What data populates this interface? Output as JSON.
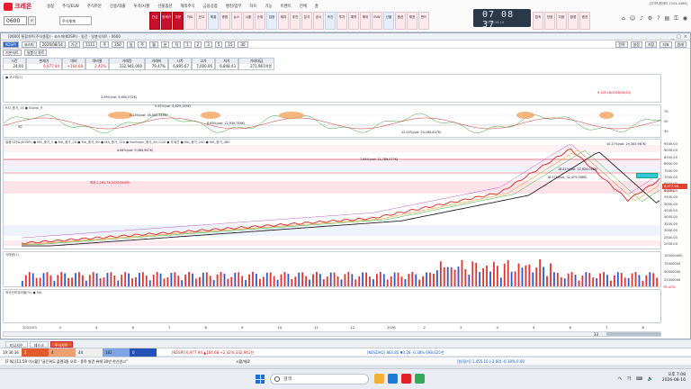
{
  "app": {
    "name": "크레온",
    "menu": [
      "설정",
      "주식/ELW",
      "주식주문",
      "신용/대출",
      "투자/시황",
      "선물옵션",
      "해외주식",
      "금융상품",
      "뱅킹/업무",
      "차트",
      "기능",
      "이벤트",
      "전체",
      "홈"
    ],
    "code_input": "0600",
    "account_select": "주식체계",
    "tiles": [
      "관심",
      "현재가",
      "주문",
      "차트",
      "잔고",
      "체결",
      "종합",
      "뉴스",
      "시황",
      "순위",
      "업종",
      "테마",
      "추천",
      "분석",
      "공시",
      "조건",
      "투자",
      "예약",
      "해외",
      "ELW",
      "선물",
      "옵션",
      "채권",
      "펀드"
    ],
    "right_tiles": [
      "접속",
      "전광",
      "다음",
      "환경",
      "증권"
    ],
    "clock": {
      "time": "07 08 37",
      "date": "2026.08.16"
    },
    "top_right_text": "[고객지원센터 1544-4488]",
    "top_icons": [
      "home-icon",
      "user-icon",
      "alarm-icon",
      "settings-icon",
      "help-icon",
      "print-icon",
      "lock-icon",
      "camera-icon"
    ]
  },
  "window": {
    "title": "[0600] 통합차트(주식종합) - 코스피(KOSPI) - 일간 - 일봉식차트 - 0600",
    "controls": [
      "_",
      "□",
      "×"
    ],
    "toolbar": [
      "KOSPI",
      "코스피",
      "2026/08/14",
      "기간",
      "1111",
      "주",
      "350",
      "일",
      "주",
      "월",
      "분",
      "틱",
      "1",
      "2",
      "3",
      "5",
      "15",
      "30"
    ],
    "toolbar2": [
      "기본차트",
      "일봉식 차트"
    ],
    "right_tools": [
      "전략",
      "설정",
      "저장"
    ],
    "right_tools2": [
      "지표",
      "원래"
    ]
  },
  "info_table": {
    "headers": [
      "시간",
      "현재가",
      "대비",
      "대비율",
      "거래량",
      "거래비",
      "시가",
      "고가",
      "저가",
      "거래대금"
    ],
    "values": [
      "24:00",
      "6,977.94",
      "+164.68",
      "2.42%",
      "332,941,000",
      "79.47%",
      "6,895.67",
      "7,000.06",
      "6,848.43",
      "271,967억원"
    ]
  },
  "panes": {
    "top_caption": "● 코스피(1)",
    "rsi_caption": "RSI_종가_14 ● Signal_9",
    "rsi_level": "50",
    "price_caption": "일봉식차트(KOSPI) ● MA_종가_5 ● MA_종가_20 ● MA_종가_60 ● MA_종가_120 ● Bollinger_종가_60,2.00 ● 추세선 ● MA_종가_240 ● MA_종가_480",
    "volume_caption": "거래량(1)",
    "foreign_caption": "외국인보유비율(%) ● MA"
  },
  "price_axis": [
    "9500.00",
    "9000.00",
    "8500.00",
    "8000.00",
    "7500.00",
    "7000.00",
    "6500.00",
    "6000.00",
    "5500.00",
    "5000.00",
    "4500.00",
    "4000.00",
    "3500.00",
    "3000.00",
    "2500.00",
    "2000.00"
  ],
  "price_tags": {
    "current": "6,977.94",
    "change_pct": "2.42%",
    "volume_now": "79.47%",
    "ma_tag": "7,053.53"
  },
  "volume_axis": [
    "100000000",
    "75000000",
    "50000000",
    "25000000"
  ],
  "rsi_axis": [
    "70",
    "50",
    "30"
  ],
  "annotations": [
    {
      "text": "3.59%(vol: 6,650,072K)"
    },
    {
      "text": "5.92%(vol: 8,829,159K)"
    },
    {
      "text": "5.13%(vol: 16,052,535K)"
    },
    {
      "text": "8.69%(vol: 12,930,766K)"
    },
    {
      "text": "12.53%(vol: 24,168,847K)"
    },
    {
      "text": "4.64%(vol: 9,084,947K)"
    },
    {
      "text": "7.64%(vol: 21,789,077K)"
    },
    {
      "text": "16.57%(vol: 32,479,586K)"
    },
    {
      "text": "18.81%(vol: 22,828,068K)"
    },
    {
      "text": "10.27%(vol: 29,345,987K)"
    },
    {
      "text": "2,283.82"
    },
    {
      "text": "2,003.93"
    },
    {
      "text": "9,135.16(2026/06/15)"
    },
    {
      "text": "최저 2,284.72(2025/04/09)"
    }
  ],
  "x_axis": [
    "2025/03",
    "4",
    "5",
    "6",
    "7",
    "8",
    "9",
    "10",
    "11",
    "12",
    "2026",
    "2",
    "3",
    "4",
    "5",
    "6",
    "7",
    "8"
  ],
  "scroll": {
    "zoom": "33"
  },
  "bottom_tabs": [
    "미니지수",
    "데스크",
    "주식차트"
  ],
  "market_bar": {
    "time": "19:36:36",
    "cells": [
      "2",
      "4",
      "44",
      "182",
      "0"
    ],
    "kospi": "[KOSPI] 6,977.94 ▲164.68 +2.42% 332,941천",
    "kosdaq": "[KOSDAQ] 864.85 ▼3.28 -0.38% 698,625천"
  },
  "news": {
    "text": "[F N] [11:59 이시황] \"골든위도 플랜3종 오로 - 종목 발견 위해 30만 한신연고\"",
    "tag": "시황/재료",
    "fx": "[원/달러] 1,455.10 (-2.60) -0.18% 0.00"
  },
  "taskbar": {
    "search_placeholder": "검색",
    "tray": "へ 가 ⌨ 🔊",
    "time": "오후 7:08",
    "date": "2026-08-16"
  }
}
